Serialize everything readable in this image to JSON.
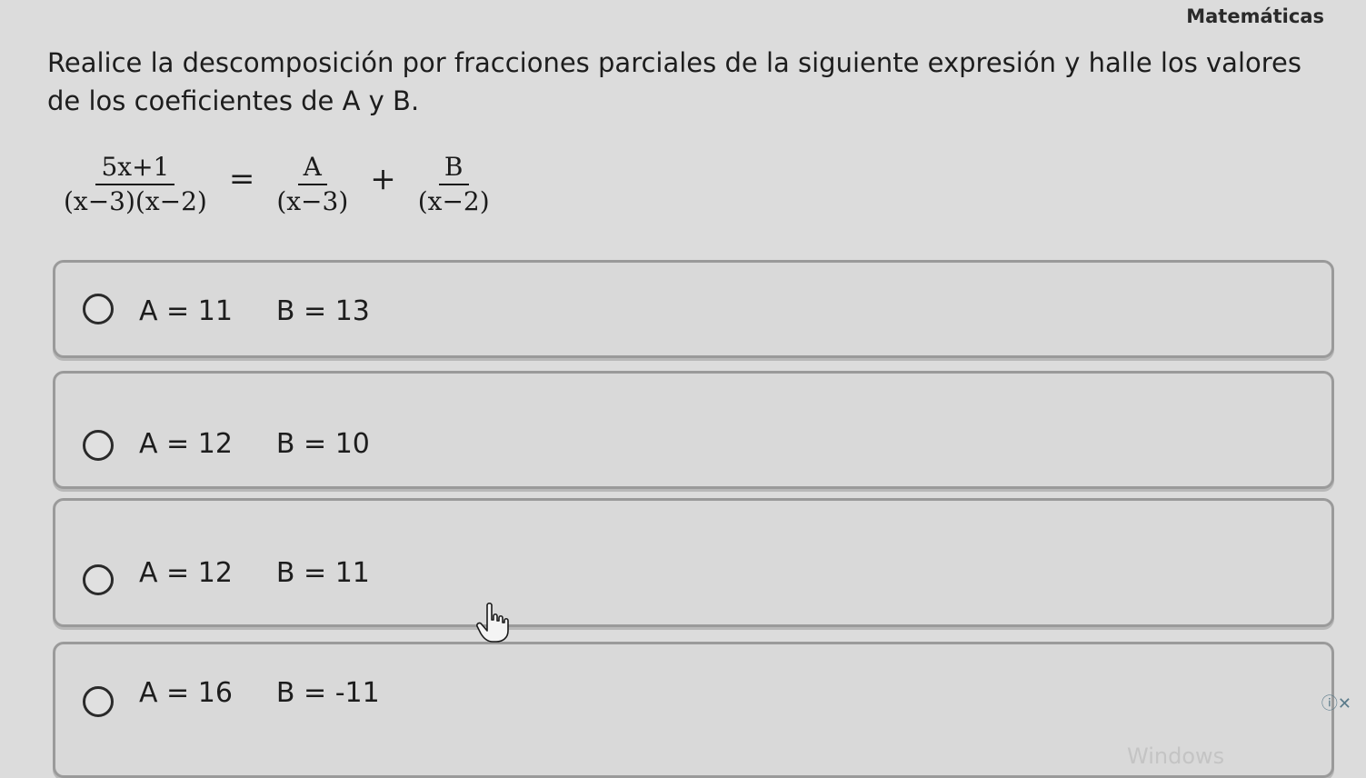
{
  "header": {
    "subject": "Matemáticas"
  },
  "question": {
    "prompt": "Realice la descomposición por fracciones parciales de la siguiente expresión y halle los valores de los coeficientes de A y B.",
    "equation": {
      "lhs_num": "5x+1",
      "lhs_den": "(x−3)(x−2)",
      "equals": "=",
      "t1_num": "A",
      "t1_den": "(x−3)",
      "plus": "+",
      "t2_num": "B",
      "t2_den": "(x−2)"
    }
  },
  "options": [
    {
      "a": "A = 11",
      "b": "B = 13"
    },
    {
      "a": "A = 12",
      "b": "B = 10"
    },
    {
      "a": "A = 12",
      "b": "B = 11"
    },
    {
      "a": "A = 16",
      "b": "B = -11"
    }
  ],
  "footer": {
    "info_close": "ⓘ✕",
    "watermark": "Windows"
  },
  "icons": {
    "cursor": "hand-pointer-icon",
    "radio": "radio-unselected-icon"
  }
}
